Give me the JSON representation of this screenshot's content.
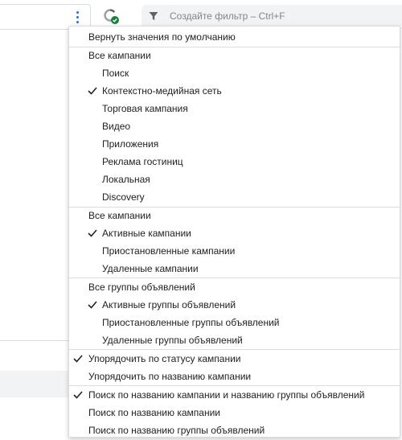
{
  "filter_bar": {
    "placeholder": "Создайте фильтр – Ctrl+F"
  },
  "colors": {
    "accent": "#1a73e8",
    "sync_badge": "#188038"
  },
  "icons": [
    "more-vert-icon",
    "sync-status-icon",
    "filter-icon",
    "checkmark-icon"
  ],
  "menu": {
    "reset": "Вернуть значения по умолчанию",
    "campaign_types": {
      "header": "Все кампании",
      "items": [
        {
          "label": "Поиск",
          "checked": false
        },
        {
          "label": "Контекстно-медийная сеть",
          "checked": true
        },
        {
          "label": "Торговая кампания",
          "checked": false
        },
        {
          "label": "Видео",
          "checked": false
        },
        {
          "label": "Приложения",
          "checked": false
        },
        {
          "label": "Реклама гостиниц",
          "checked": false
        },
        {
          "label": "Локальная",
          "checked": false
        },
        {
          "label": "Discovery",
          "checked": false
        }
      ]
    },
    "campaign_status": {
      "header": "Все кампании",
      "items": [
        {
          "label": "Активные кампании",
          "checked": true
        },
        {
          "label": "Приостановленные кампании",
          "checked": false
        },
        {
          "label": "Удаленные кампании",
          "checked": false
        }
      ]
    },
    "adgroup_status": {
      "header": "Все группы объявлений",
      "items": [
        {
          "label": "Активные группы объявлений",
          "checked": true
        },
        {
          "label": "Приостановленные группы объявлений",
          "checked": false
        },
        {
          "label": "Удаленные группы объявлений",
          "checked": false
        }
      ]
    },
    "sort": {
      "items": [
        {
          "label": "Упорядочить по статусу кампании",
          "checked": true
        },
        {
          "label": "Упорядочить по названию кампании",
          "checked": false
        }
      ]
    },
    "search": {
      "items": [
        {
          "label": "Поиск по названию кампании и названию группы объявлений",
          "checked": true
        },
        {
          "label": "Поиск по названию кампании",
          "checked": false
        },
        {
          "label": "Поиск по названию группы объявлений",
          "checked": false
        }
      ]
    }
  }
}
